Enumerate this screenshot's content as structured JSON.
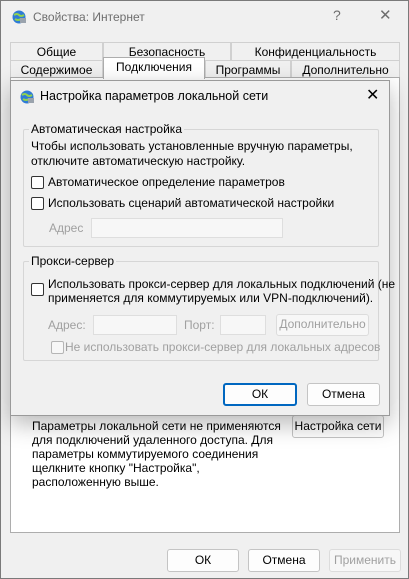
{
  "window": {
    "title": "Свойства: Интернет",
    "help_glyph": "?",
    "close_glyph": "✕",
    "icon": "internet-options-icon"
  },
  "tabs": {
    "row1": [
      "Общие",
      "Безопасность",
      "Конфиденциальность"
    ],
    "row2": [
      "Содержимое",
      "Подключения",
      "Программы",
      "Дополнительно"
    ],
    "active": "Подключения"
  },
  "panel": {
    "lan_text": "Параметры локальной сети не применяются для подключений удаленного доступа. Для параметры коммутируемого соединения щелкните кнопку \"Настройка\", расположенную выше.",
    "lan_button": "Настройка сети"
  },
  "footer": {
    "ok": "ОК",
    "cancel": "Отмена",
    "apply": "Применить"
  },
  "dialog": {
    "title": "Настройка параметров локальной сети",
    "close_glyph": "✕",
    "auto": {
      "legend": "Автоматическая настройка",
      "description": "Чтобы использовать установленные вручную параметры, отключите автоматическую настройку.",
      "auto_detect": {
        "label": "Автоматическое определение параметров",
        "checked": false
      },
      "use_script": {
        "label": "Использовать сценарий автоматической настройки",
        "checked": false
      },
      "address_label": "Адрес",
      "address_value": ""
    },
    "proxy": {
      "legend": "Прокси-сервер",
      "use_proxy": {
        "label_line1": "Использовать прокси-сервер для локальных подключений (не",
        "label_line2": "применяется для коммутируемых или VPN-подключений).",
        "checked": false
      },
      "address_label": "Адрес:",
      "address_value": "",
      "port_label": "Порт:",
      "port_value": "",
      "advanced_button": "Дополнительно",
      "bypass_local": {
        "label": "Не использовать прокси-сервер для локальных адресов",
        "checked": false
      }
    },
    "ok": "ОК",
    "cancel": "Отмена"
  },
  "colors": {
    "accent": "#0067c0",
    "disabled_text": "#a0a0a0",
    "window_bg": "#f0f0f0"
  }
}
